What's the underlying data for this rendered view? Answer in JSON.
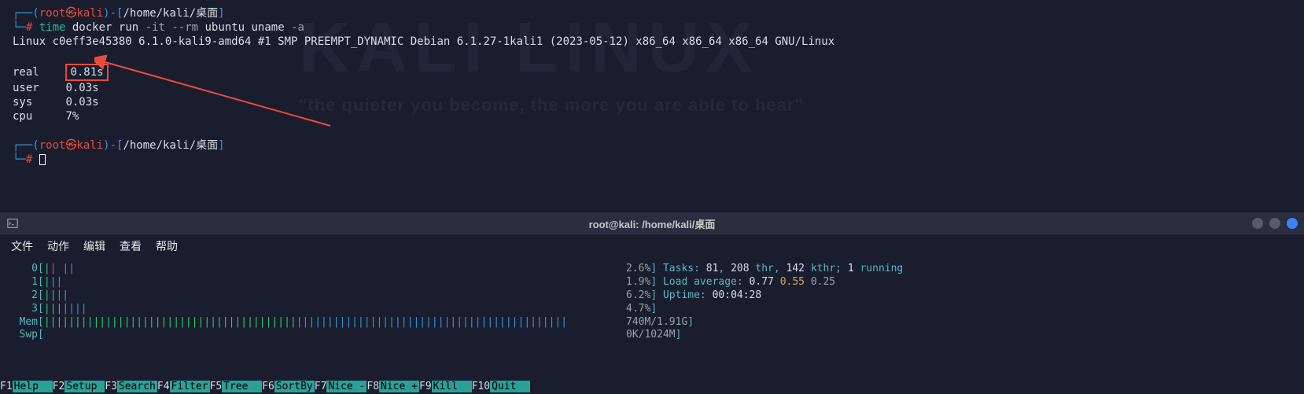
{
  "watermark": {
    "title": "KALI LINUX",
    "subtitle": "\"the quieter you become, the more you are able to hear\""
  },
  "prompt1": {
    "corner_top": "┌──(",
    "user": "root",
    "sep": "㉿",
    "host": "kali",
    "paren": ")-[",
    "path": "/home/kali/桌面",
    "close": "]",
    "corner_bot": "└─",
    "hash": "#"
  },
  "command": {
    "c1": "time",
    "c2": " docker ",
    "c3": "run",
    "c4": " -it --rm ",
    "c5": "ubuntu uname ",
    "c6": "-a"
  },
  "output_line": "Linux c0eff3e45380 6.1.0-kali9-amd64 #1 SMP PREEMPT_DYNAMIC Debian 6.1.27-1kali1 (2023-05-12) x86_64 x86_64 x86_64 GNU/Linux",
  "timing": {
    "real_label": "real",
    "real_val": "0.81s",
    "user_label": "user",
    "user_val": "0.03s",
    "sys_label": "sys",
    "sys_val": "0.03s",
    "cpu_label": "cpu",
    "cpu_val": "7%"
  },
  "titlebar": {
    "title": "root@kali: /home/kali/桌面"
  },
  "menu": {
    "m1": "文件",
    "m2": "动作",
    "m3": "编辑",
    "m4": "查看",
    "m5": "帮助"
  },
  "htop": {
    "cpu0_pct": "2.6%",
    "cpu1_pct": "1.9%",
    "cpu2_pct": "6.2%",
    "cpu3_pct": "4.7%",
    "mem_label": "Mem",
    "mem_val": "740M/1.91G",
    "swp_label": "Swp",
    "swp_val": "0K/1024M",
    "tasks_label": "Tasks: ",
    "tasks_n": "81",
    "tasks_sep1": ", ",
    "thr_n": "208",
    "thr_lbl": " thr, ",
    "kthr_n": "142",
    "kthr_lbl": " kthr; ",
    "run_n": "1",
    "run_lbl": " running",
    "load_label": "Load average: ",
    "load1": "0.77",
    "load2": "0.55",
    "load3": "0.25",
    "uptime_label": "Uptime: ",
    "uptime_val": "00:04:28"
  },
  "footer": {
    "f1k": "F1",
    "f1a": "Help  ",
    "f2k": "F2",
    "f2a": "Setup ",
    "f3k": "F3",
    "f3a": "Search",
    "f4k": "F4",
    "f4a": "Filter",
    "f5k": "F5",
    "f5a": "Tree  ",
    "f6k": "F6",
    "f6a": "SortBy",
    "f7k": "F7",
    "f7a": "Nice -",
    "f8k": "F8",
    "f8a": "Nice +",
    "f9k": "F9",
    "f9a": "Kill  ",
    "f10k": "F10",
    "f10a": "Quit  "
  }
}
